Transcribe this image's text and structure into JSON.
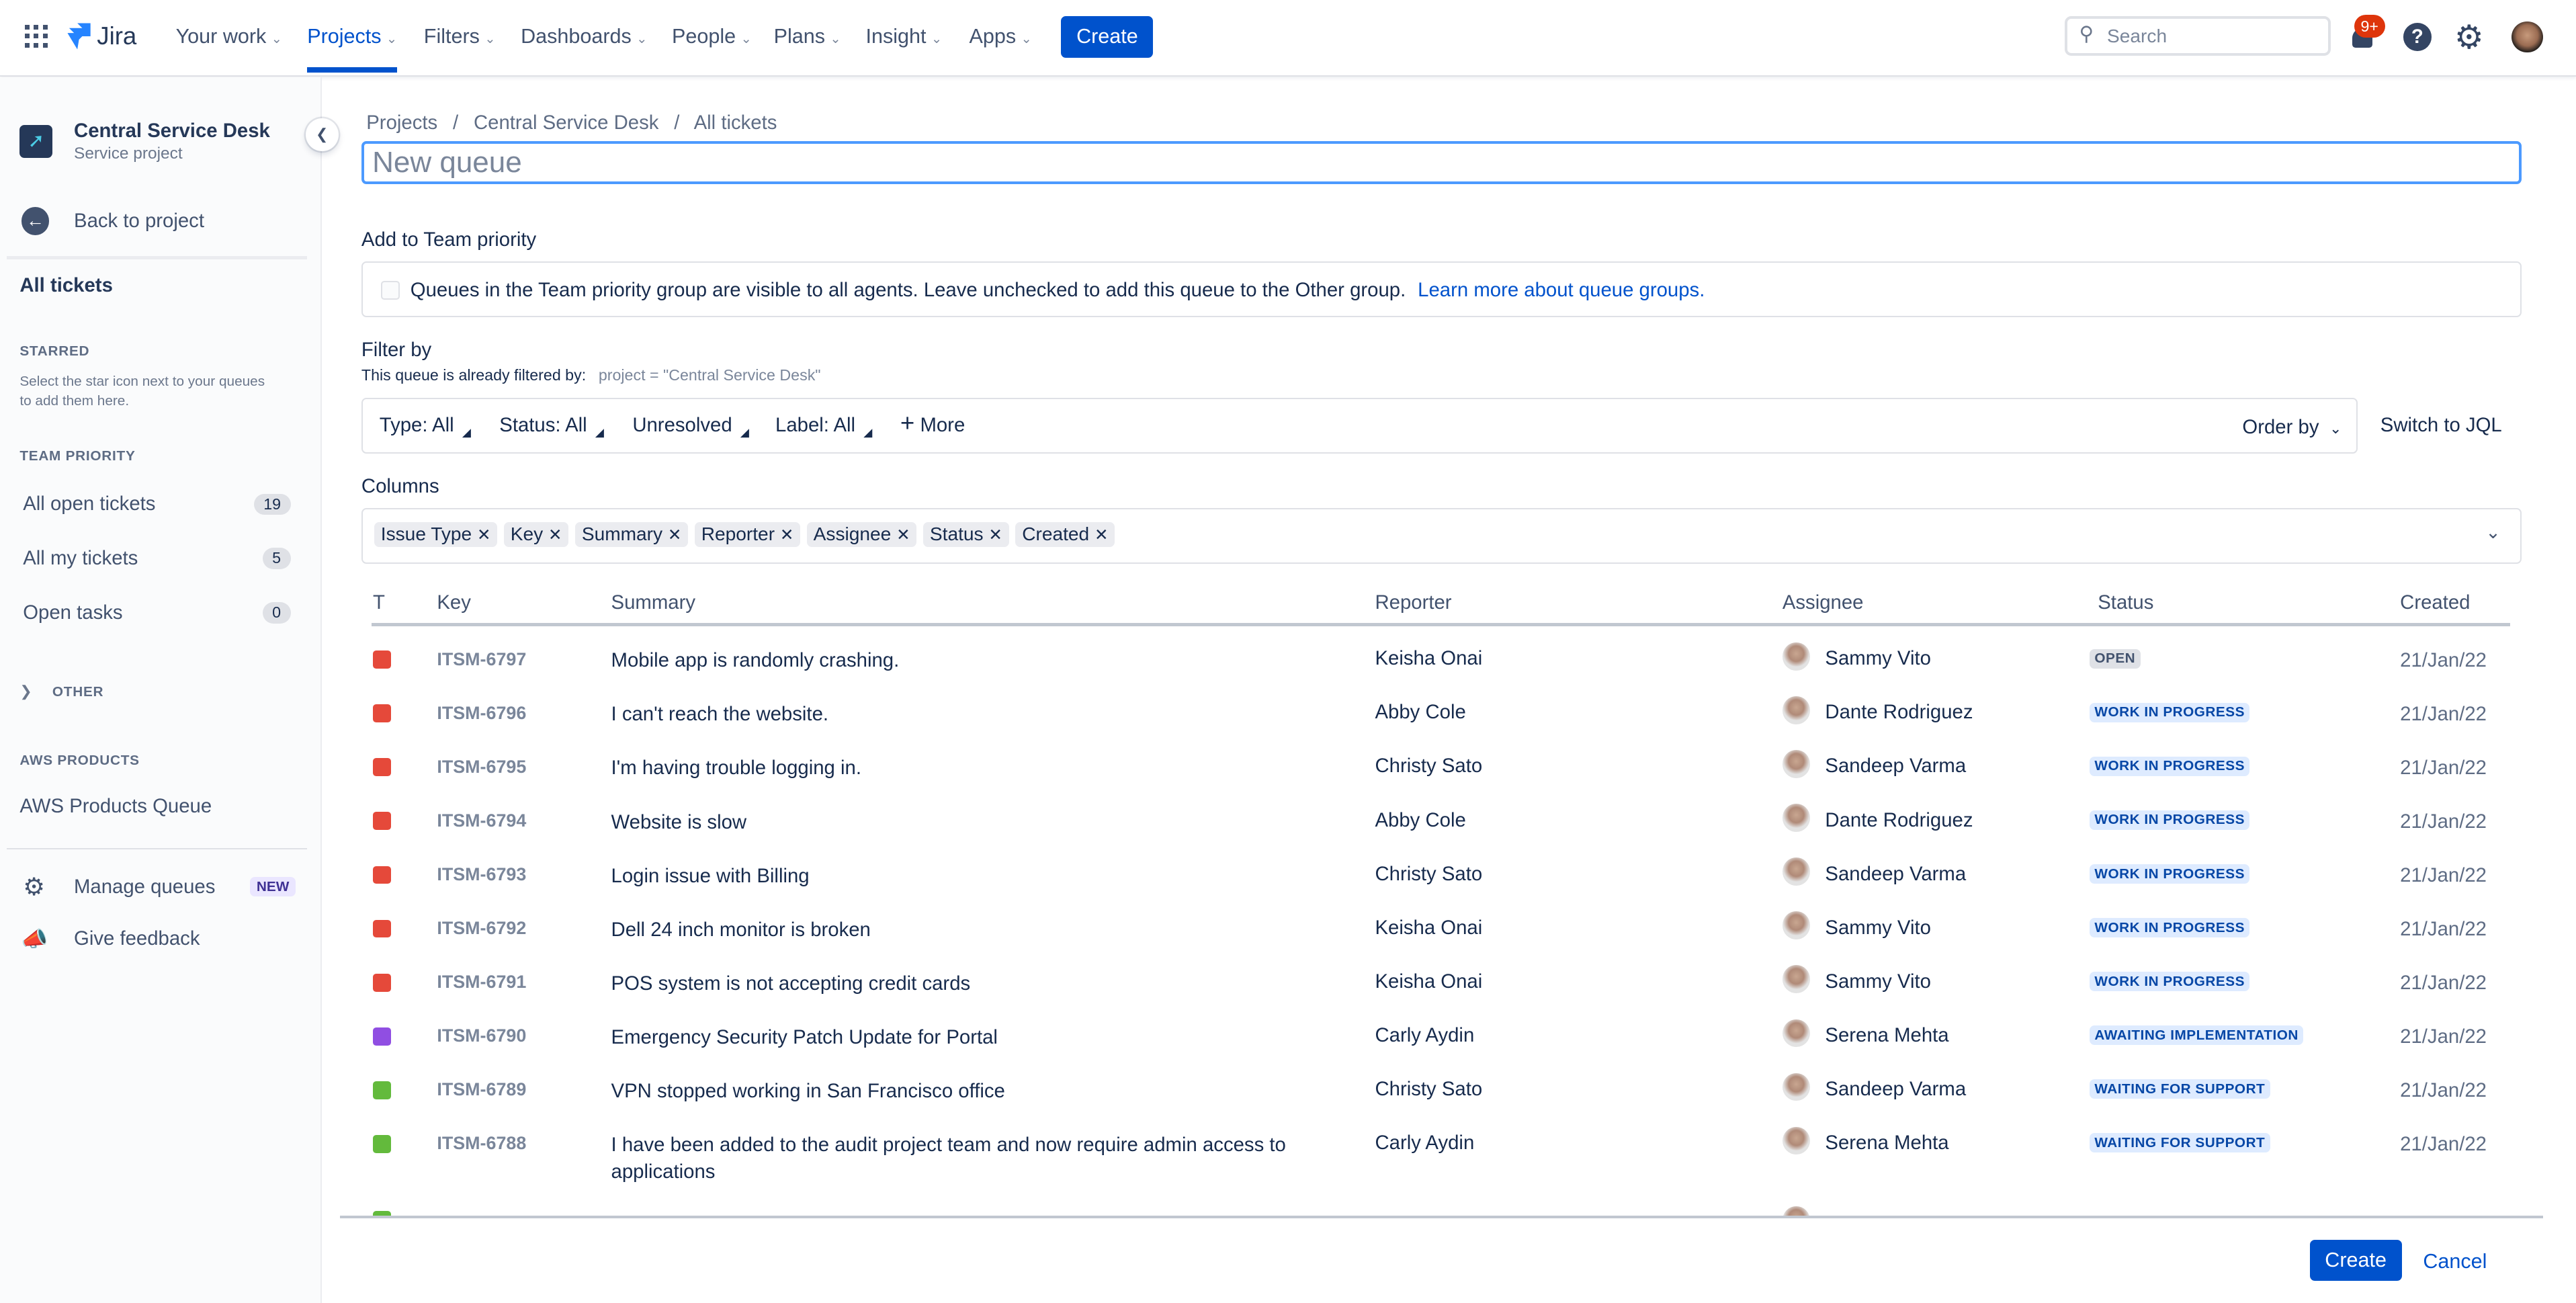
{
  "nav": {
    "logo": "Jira",
    "items": [
      {
        "label": "Your work"
      },
      {
        "label": "Projects",
        "active": true
      },
      {
        "label": "Filters"
      },
      {
        "label": "Dashboards"
      },
      {
        "label": "People"
      },
      {
        "label": "Plans"
      },
      {
        "label": "Insight"
      },
      {
        "label": "Apps"
      }
    ],
    "create_label": "Create",
    "search_placeholder": "Search",
    "notifications_count": "9+",
    "icons": [
      "app-switcher-icon",
      "bell-icon",
      "help-icon",
      "settings-icon",
      "avatar"
    ]
  },
  "sidebar": {
    "project_name": "Central Service Desk",
    "project_type": "Service project",
    "back_label": "Back to project",
    "all_tickets": "All tickets",
    "starred_heading": "STARRED",
    "starred_desc_1": "Select the star icon next to your queues",
    "starred_desc_2": "to add them here.",
    "team_priority_heading": "TEAM PRIORITY",
    "team_items": [
      {
        "label": "All open tickets",
        "count": "19"
      },
      {
        "label": "All my tickets",
        "count": "5"
      },
      {
        "label": "Open tasks",
        "count": "0"
      }
    ],
    "other_heading": "OTHER",
    "aws_heading": "AWS PRODUCTS",
    "aws_item": "AWS Products Queue",
    "manage_queues": "Manage queues",
    "new_badge": "NEW",
    "give_feedback": "Give feedback"
  },
  "main": {
    "breadcrumb": [
      "Projects",
      "Central Service Desk",
      "All tickets"
    ],
    "title_placeholder": "New queue",
    "team_priority_label": "Add to Team priority",
    "team_priority_checked": false,
    "team_priority_desc": "Queues in the Team priority group are visible to all agents. Leave unchecked to add this queue to the Other group.",
    "learn_more": "Learn more about queue groups.",
    "filter_by": "Filter by",
    "filter_sub": "This queue is already filtered by:",
    "filter_jql": "project = \"Central Service Desk\"",
    "filters": [
      "Type: All",
      "Status: All",
      "Unresolved",
      "Label: All"
    ],
    "more": "More",
    "order_by": "Order by",
    "switch_jql": "Switch to JQL",
    "columns_label": "Columns",
    "columns": [
      "Issue Type",
      "Key",
      "Summary",
      "Reporter",
      "Assignee",
      "Status",
      "Created"
    ]
  },
  "table": {
    "headers": [
      "T",
      "Key",
      "Summary",
      "Reporter",
      "Assignee",
      "Status",
      "Created"
    ],
    "rows": [
      {
        "type": "bug",
        "key": "ITSM-6797",
        "summary": "Mobile app is randomly crashing.",
        "reporter": "Keisha Onai",
        "assignee": "Sammy Vito",
        "status": "OPEN",
        "created": "21/Jan/22"
      },
      {
        "type": "bug",
        "key": "ITSM-6796",
        "summary": "I can't reach the website.",
        "reporter": "Abby Cole",
        "assignee": "Dante Rodriguez",
        "status": "WORK IN PROGRESS",
        "created": "21/Jan/22"
      },
      {
        "type": "bug",
        "key": "ITSM-6795",
        "summary": "I'm having trouble logging in.",
        "reporter": "Christy Sato",
        "assignee": "Sandeep Varma",
        "status": "WORK IN PROGRESS",
        "created": "21/Jan/22"
      },
      {
        "type": "bug",
        "key": "ITSM-6794",
        "summary": "Website is slow",
        "reporter": "Abby Cole",
        "assignee": "Dante Rodriguez",
        "status": "WORK IN PROGRESS",
        "created": "21/Jan/22"
      },
      {
        "type": "bug",
        "key": "ITSM-6793",
        "summary": "Login issue with Billing",
        "reporter": "Christy Sato",
        "assignee": "Sandeep Varma",
        "status": "WORK IN PROGRESS",
        "created": "21/Jan/22"
      },
      {
        "type": "bug",
        "key": "ITSM-6792",
        "summary": "Dell 24 inch monitor is broken",
        "reporter": "Keisha Onai",
        "assignee": "Sammy Vito",
        "status": "WORK IN PROGRESS",
        "created": "21/Jan/22"
      },
      {
        "type": "bug",
        "key": "ITSM-6791",
        "summary": "POS system is not accepting credit cards",
        "reporter": "Keisha Onai",
        "assignee": "Sammy Vito",
        "status": "WORK IN PROGRESS",
        "created": "21/Jan/22"
      },
      {
        "type": "change",
        "key": "ITSM-6790",
        "summary": "Emergency Security Patch Update for Portal",
        "reporter": "Carly Aydin",
        "assignee": "Serena Mehta",
        "status": "AWAITING IMPLEMENTATION",
        "created": "21/Jan/22"
      },
      {
        "type": "service-request",
        "key": "ITSM-6789",
        "summary": "VPN stopped working in San Francisco office",
        "reporter": "Christy Sato",
        "assignee": "Sandeep Varma",
        "status": "WAITING FOR SUPPORT",
        "created": "21/Jan/22"
      },
      {
        "type": "service-request",
        "key": "ITSM-6788",
        "summary": "I have been added to the audit project team and now require admin access to",
        "summary_line2": "applications",
        "reporter": "Carly Aydin",
        "assignee": "Serena Mehta",
        "status": "WAITING FOR SUPPORT",
        "created": "21/Jan/22"
      }
    ]
  },
  "type_colors": {
    "bug": "#e5493a",
    "change": "#904ee2",
    "service-request": "#63ba3c"
  },
  "footer": {
    "create": "Create",
    "cancel": "Cancel"
  }
}
